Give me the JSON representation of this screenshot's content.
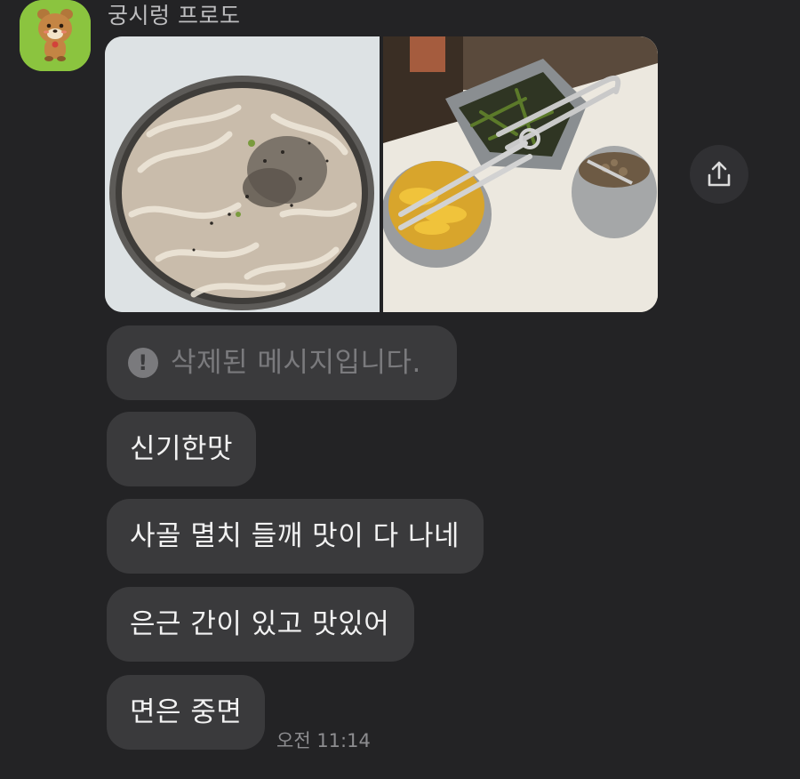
{
  "chat": {
    "sender_name": "궁시렁 프로도",
    "deleted_notice": "삭제된 메시지입니다.",
    "messages": [
      {
        "text": "신기한맛"
      },
      {
        "text": "사골 멸치 들깨 맛이 다 나네"
      },
      {
        "text": "은근 간이 있고 맛있어"
      },
      {
        "text": "면은 중면"
      }
    ],
    "timestamp": "오전 11:14"
  },
  "icons": {
    "share": "share-upload-icon",
    "deleted": "exclamation-circle-icon",
    "avatar": "frodo-character-avatar"
  },
  "colors": {
    "background": "#232325",
    "bubble": "#3a3a3c",
    "avatar_bg": "#8bc43f"
  }
}
